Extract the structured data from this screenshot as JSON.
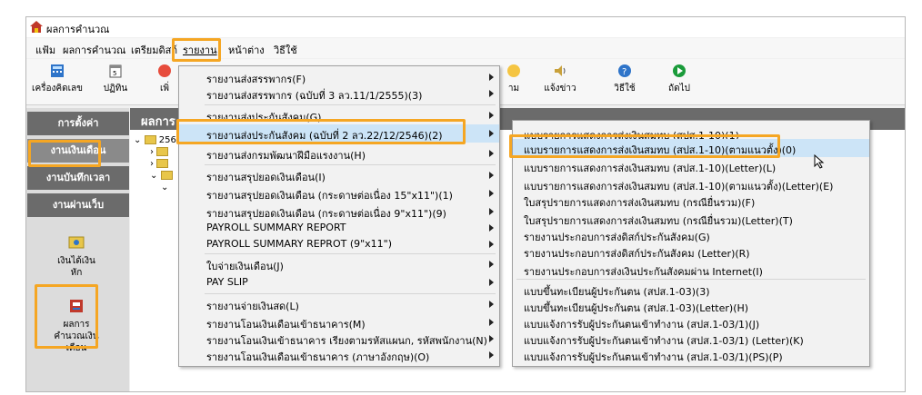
{
  "window": {
    "title": "ผลการคำนวณ"
  },
  "menubar": {
    "items": [
      "แฟ้ม",
      "ผลการคำนวณ",
      "เตรียมดิสก์",
      "รายงาน",
      "หน้าต่าง",
      "วิธีใช้"
    ]
  },
  "toolbar": {
    "buttons": [
      {
        "label": "เครื่องคิดเลข",
        "icon": "calculator-icon"
      },
      {
        "label": "ปฏิทิน",
        "icon": "calendar-icon"
      },
      {
        "label": "เพิ่",
        "icon": "add-icon"
      },
      {
        "label": "าม",
        "icon": "question-icon"
      },
      {
        "label": "แจ้งข่าว",
        "icon": "speaker-icon"
      },
      {
        "label": "วิธีใช้",
        "icon": "help-icon"
      },
      {
        "label": "ถัดไป",
        "icon": "next-icon"
      }
    ]
  },
  "sidebar": {
    "items": [
      "การตั้งค่า",
      "งานเงินเดือน",
      "งานบันทึกเวลา",
      "งานผ่านเว็บ"
    ],
    "icon_items": [
      {
        "label_lines": [
          "เงินได้เงิน",
          "หัก"
        ],
        "icon": "money-icon"
      },
      {
        "label_lines": [
          "ผลการ",
          "คำนวณเงิน",
          "เดือน"
        ],
        "icon": "calc-result-icon"
      }
    ]
  },
  "content": {
    "title": "ผลการ",
    "tree_root": "256"
  },
  "report_menu": {
    "items": [
      {
        "label": "รายงานส่งสรรพากร(F)",
        "submenu": true
      },
      {
        "label": "รายงานส่งสรรพากร (ฉบับที่ 3 ลว.11/1/2555)(3)",
        "submenu": true
      },
      {
        "label": "รายงานส่งประกันสังคม(G)",
        "submenu": true
      },
      {
        "label": "รายงานส่งประกันสังคม (ฉบับที่ 2 ลว.22/12/2546)(2)",
        "submenu": true
      },
      {
        "label": "รายงานส่งกรมพัฒนาฝีมือแรงงาน(H)",
        "submenu": true
      },
      {
        "label": "รายงานสรุปยอดเงินเดือน(I)",
        "submenu": true
      },
      {
        "label": "รายงานสรุปยอดเงินเดือน (กระดาษต่อเนื่อง 15\"x11\")(1)",
        "submenu": true
      },
      {
        "label": "รายงานสรุปยอดเงินเดือน (กระดาษต่อเนื่อง 9\"x11\")(9)",
        "submenu": true
      },
      {
        "label": "PAYROLL SUMMARY REPORT",
        "submenu": true
      },
      {
        "label": "PAYROLL SUMMARY REPROT (9\"x11\")",
        "submenu": true
      },
      {
        "label": "ใบจ่ายเงินเดือน(J)",
        "submenu": true
      },
      {
        "label": "PAY SLIP",
        "submenu": true
      },
      {
        "label": "รายงานจ่ายเงินสด(L)",
        "submenu": true
      },
      {
        "label": "รายงานโอนเงินเดือนเข้าธนาคาร(M)",
        "submenu": true
      },
      {
        "label": "รายงานโอนเงินเข้าธนาคาร เรียงตามรหัสแผนก, รหัสพนักงาน(N)",
        "submenu": true
      },
      {
        "label": "รายงานโอนเงินเดือนเข้าธนาคาร (ภาษาอังกฤษ)(O)",
        "submenu": true
      }
    ]
  },
  "social_security_submenu": {
    "items": [
      "แบบรายการแสดงการส่งเงินสมทบ (สปส.1-10)(1)",
      "แบบรายการแสดงการส่งเงินสมทบ (สปส.1-10)(ตามแนวตั้ง)(0)",
      "แบบรายการแสดงการส่งเงินสมทบ (สปส.1-10)(Letter)(L)",
      "แบบรายการแสดงการส่งเงินสมทบ (สปส.1-10)(ตามแนวตั้ง)(Letter)(E)",
      "ใบสรุปรายการแสดงการส่งเงินสมทบ (กรณียื่นรวม)(F)",
      "ใบสรุปรายการแสดงการส่งเงินสมทบ (กรณียื่นรวม)(Letter)(T)",
      "รายงานประกอบการส่งดิสก์ประกันสังคม(G)",
      "รายงานประกอบการส่งดิสก์ประกันสังคม (Letter)(R)",
      "รายงานประกอบการส่งเงินประกันสังคมผ่าน Internet(I)",
      "แบบขึ้นทะเบียนผู้ประกันตน (สปส.1-03)(3)",
      "แบบขึ้นทะเบียนผู้ประกันตน (สปส.1-03)(Letter)(H)",
      "แบบแจ้งการรับผู้ประกันตนเข้าทำงาน (สปส.1-03/1)(J)",
      "แบบแจ้งการรับผู้ประกันตนเข้าทำงาน (สปส.1-03/1) (Letter)(K)",
      "แบบแจ้งการรับผู้ประกันตนเข้าทำงาน (สปส.1-03/1)(PS)(P)"
    ]
  },
  "colors": {
    "highlight": "#cce4f7",
    "callout": "#f5a623",
    "sidebar_dark": "#6b6b6b"
  }
}
